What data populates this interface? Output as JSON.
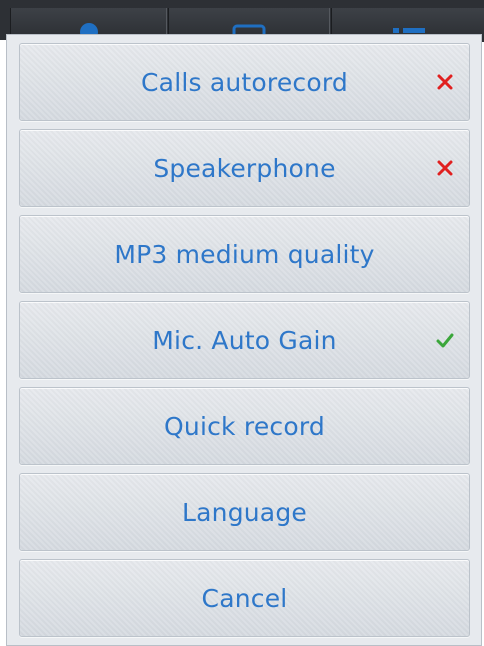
{
  "menu": {
    "items": [
      {
        "label": "Calls autorecord",
        "state": "off",
        "state_icon": "cross-icon",
        "state_color": "#e02020"
      },
      {
        "label": "Speakerphone",
        "state": "off",
        "state_icon": "cross-icon",
        "state_color": "#e02020"
      },
      {
        "label": "MP3 medium quality",
        "state": null
      },
      {
        "label": "Mic. Auto Gain",
        "state": "on",
        "state_icon": "check-icon",
        "state_color": "#3aa63a"
      },
      {
        "label": "Quick record",
        "state": null
      },
      {
        "label": "Language",
        "state": null
      },
      {
        "label": "Cancel",
        "state": null
      }
    ]
  },
  "colors": {
    "label": "#2e77c9",
    "toolbar": "#2d3035",
    "menu_bg": "#e7eaee"
  }
}
